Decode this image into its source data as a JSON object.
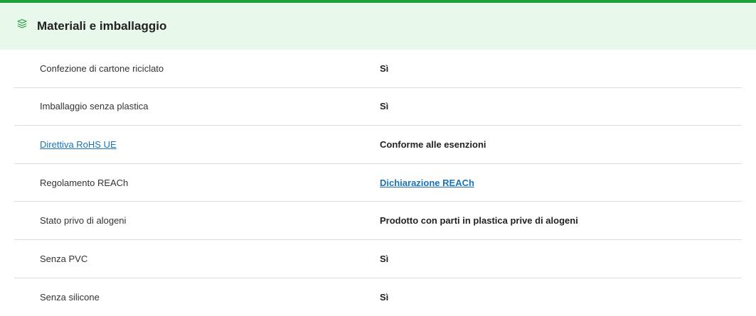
{
  "header": {
    "title": "Materiali e imballaggio",
    "icon": "layers-icon",
    "accent_color": "#1e9e3c",
    "background_color": "#e8f8ea"
  },
  "rows": [
    {
      "label": "Confezione di cartone riciclato",
      "value": "Sì"
    },
    {
      "label": "Imballaggio senza plastica",
      "value": "Sì"
    },
    {
      "label": "Direttiva RoHS UE",
      "value": "Conforme alle esenzioni",
      "label_is_link": true
    },
    {
      "label": "Regolamento REACh",
      "value": "Dichiarazione REACh",
      "value_is_link": true
    },
    {
      "label": "Stato privo di alogeni",
      "value": "Prodotto con parti in plastica prive di alogeni"
    },
    {
      "label": "Senza PVC",
      "value": "Sì"
    },
    {
      "label": "Senza silicone",
      "value": "Sì"
    }
  ],
  "link_color": "#1a73b8"
}
